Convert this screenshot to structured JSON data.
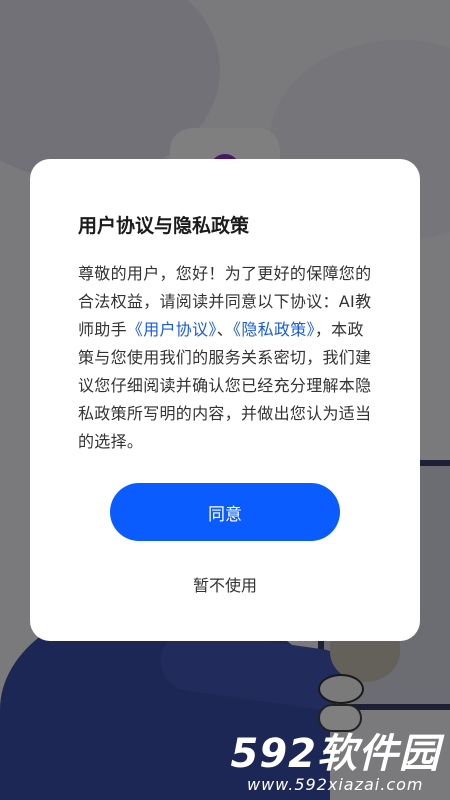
{
  "dialog": {
    "title": "用户协议与隐私政策",
    "body_intro": "尊敬的用户，您好！为了更好的保障您的合法权益，请阅读并同意以下协议：AI教师助手",
    "user_agreement_link": "《用户协议》",
    "separator": "、",
    "privacy_policy_link": "《隐私政策》",
    "body_rest": "，本政策与您使用我们的服务关系密切，我们建议您仔细阅读并确认您已经充分理解本隐私政策所写明的内容，并做出您认为适当的选择。",
    "agree_label": "同意",
    "decline_label": "暂不使用"
  },
  "watermark": {
    "number": "592",
    "name": "软件园",
    "url": "www.592xiazai.com"
  },
  "colors": {
    "accent": "#0b5cff",
    "link": "#1a5be0",
    "overlay": "rgba(0,0,0,0.5)"
  }
}
